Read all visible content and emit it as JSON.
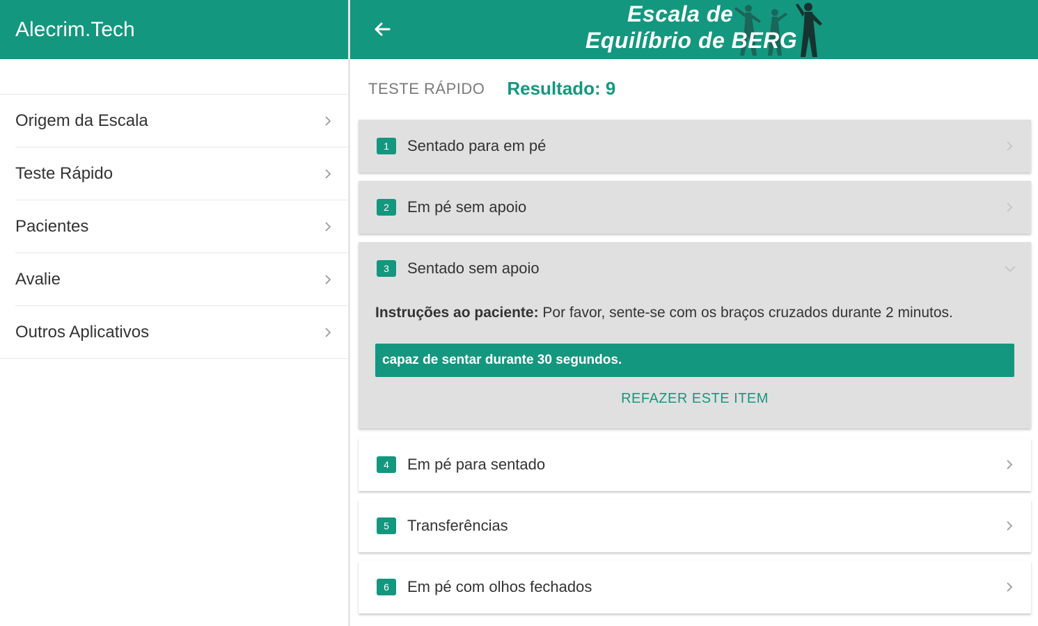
{
  "sidebar": {
    "title": "Alecrim.Tech",
    "items": [
      {
        "label": "Origem da Escala",
        "icon": "chevron-right-icon"
      },
      {
        "label": "Teste Rápido",
        "icon": "chevron-right-icon"
      },
      {
        "label": "Pacientes",
        "icon": "chevron-right-icon"
      },
      {
        "label": "Avalie",
        "icon": "chevron-right-icon"
      },
      {
        "label": "Outros Aplicativos",
        "icon": "chevron-right-icon"
      }
    ]
  },
  "header": {
    "back_icon": "arrow-left-icon",
    "banner_line1": "Escala de",
    "banner_line2": "Equilíbrio de BERG"
  },
  "subheader": {
    "label": "TESTE RÁPIDO",
    "result": "Resultado: 9"
  },
  "items": [
    {
      "number": "1",
      "title": "Sentado para em pé",
      "state": "answered"
    },
    {
      "number": "2",
      "title": "Em pé sem apoio",
      "state": "answered"
    },
    {
      "number": "3",
      "title": "Sentado sem apoio",
      "state": "expanded",
      "instructions_label": "Instruções ao paciente:",
      "instructions_text": " Por favor, sente-se com os braços cruzados durante 2 minutos.",
      "answer": "capaz de sentar durante 30 segundos.",
      "redo_label": "REFAZER ESTE ITEM"
    },
    {
      "number": "4",
      "title": "Em pé para sentado",
      "state": "pending"
    },
    {
      "number": "5",
      "title": "Transferências",
      "state": "pending"
    },
    {
      "number": "6",
      "title": "Em pé com olhos fechados",
      "state": "pending"
    }
  ],
  "colors": {
    "primary": "#14977f",
    "answered_bg": "#e0e0e0",
    "text": "#333333"
  }
}
